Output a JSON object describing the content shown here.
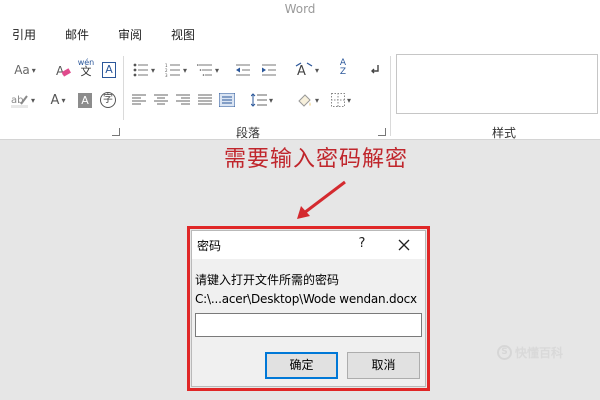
{
  "app": {
    "title": "Word"
  },
  "tabs": [
    "引用",
    "邮件",
    "审阅",
    "视图"
  ],
  "ribbon": {
    "font_row1": {
      "aa_label": "Aa",
      "wen_label": "wén",
      "wen_sub": "文",
      "a_label": "A"
    },
    "font_row2": {
      "a_label": "A",
      "zi_label": "字"
    },
    "paragraph_group_label": "段落",
    "styles_group_label": "样式",
    "sort_label_top": "A",
    "sort_label_bottom": "Z"
  },
  "annotation": {
    "text": "需要输入密码解密",
    "color": "#c0262c"
  },
  "dialog": {
    "title": "密码",
    "help_label": "?",
    "prompt": "请键入打开文件所需的密码",
    "file_path": "C:\\...acer\\Desktop\\Wode wendan.docx",
    "password_value": "",
    "ok_label": "确定",
    "cancel_label": "取消",
    "highlight_color": "#e02727"
  },
  "watermark": {
    "icon_text": "S",
    "text": "快懂百科"
  },
  "icons": [
    "font-size-icon",
    "eraser-icon",
    "phonetic-guide-icon",
    "char-border-icon",
    "bullets-icon",
    "numbering-icon",
    "multilevel-list-icon",
    "decrease-indent-icon",
    "increase-indent-icon",
    "chinese-layout-icon",
    "sort-icon",
    "show-marks-icon",
    "highlight-icon",
    "font-color-icon",
    "char-shading-icon",
    "enclose-char-icon",
    "align-left-icon",
    "center-icon",
    "align-right-icon",
    "justify-icon",
    "distributed-icon",
    "line-spacing-icon",
    "shading-icon",
    "borders-icon",
    "close-icon"
  ]
}
